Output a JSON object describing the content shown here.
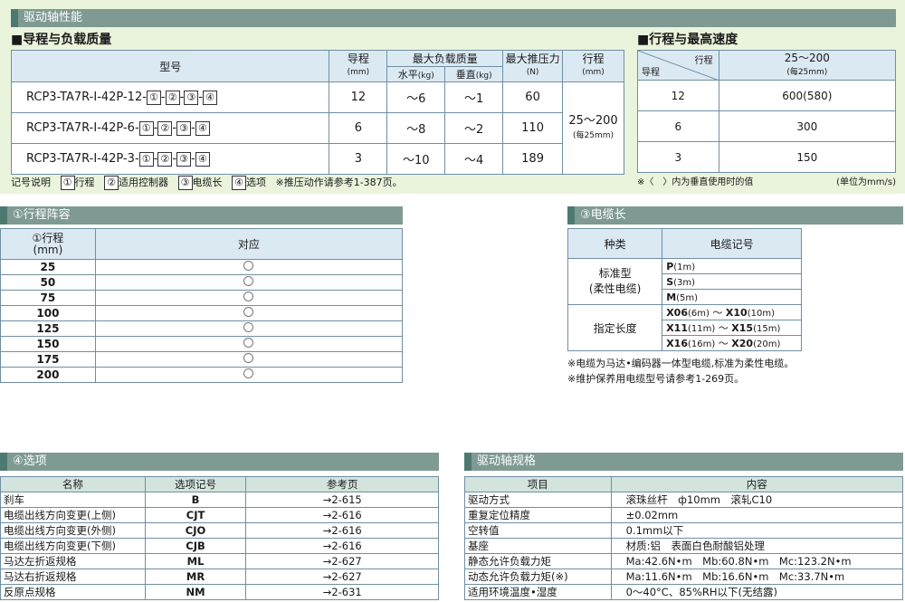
{
  "top_section": {
    "title": "驱动轴性能",
    "lead_table": {
      "heading": "■导程与负载质量",
      "h_model": "型号",
      "h_lead": "导程",
      "h_lead_unit": "(mm)",
      "h_max_load": "最大负载质量",
      "h_horizontal": "水平",
      "h_horizontal_unit": "(kg)",
      "h_vertical": "垂直",
      "h_vertical_unit": "(kg)",
      "h_max_push": "最大推压力",
      "h_max_push_unit": "(N)",
      "h_stroke": "行程",
      "h_stroke_unit": "(mm)",
      "stroke_value": "25～200",
      "stroke_step": "(每25mm)",
      "rows": [
        {
          "model_prefix": "RCP3-TA7R-I-42P-12-",
          "lead": "12",
          "horizontal": "～6",
          "vertical": "～1",
          "push": "60"
        },
        {
          "model_prefix": "RCP3-TA7R-I-42P-6-",
          "lead": "6",
          "horizontal": "～8",
          "vertical": "～2",
          "push": "110"
        },
        {
          "model_prefix": "RCP3-TA7R-I-42P-3-",
          "lead": "3",
          "horizontal": "～10",
          "vertical": "～4",
          "push": "189"
        }
      ],
      "model_boxes": [
        "①",
        "②",
        "③",
        "④"
      ],
      "model_dash": "-",
      "legend_label": "记号说明",
      "legend_items": [
        {
          "num": "①",
          "text": "行程"
        },
        {
          "num": "②",
          "text": "适用控制器"
        },
        {
          "num": "③",
          "text": "电缆长"
        },
        {
          "num": "④",
          "text": "选项"
        }
      ],
      "legend_note": "※推压动作请参考1-387页。"
    },
    "speed_table": {
      "heading": "■行程与最高速度",
      "h_stroke": "行程",
      "h_lead": "导程",
      "h_range": "25～200",
      "h_range_step": "(每25mm)",
      "rows": [
        {
          "lead": "12",
          "speed": "600(580)"
        },
        {
          "lead": "6",
          "speed": "300"
        },
        {
          "lead": "3",
          "speed": "150"
        }
      ],
      "note": "※〈　〉内为垂直使用时的值",
      "unit": "(单位为mm/s)"
    }
  },
  "stroke_section": {
    "title": "①行程阵容",
    "h_stroke": "①行程",
    "h_stroke_unit": "(mm)",
    "h_support": "对应",
    "rows": [
      "25",
      "50",
      "75",
      "100",
      "125",
      "150",
      "175",
      "200"
    ]
  },
  "cable_section": {
    "title": "③电缆长",
    "h_type": "种类",
    "h_code": "电缆记号",
    "standard_label": "标准型",
    "standard_sub": "(柔性电缆)",
    "standard_rows": [
      {
        "code": "P",
        "len": "(1m)"
      },
      {
        "code": "S",
        "len": "(3m)"
      },
      {
        "code": "M",
        "len": "(5m)"
      }
    ],
    "custom_label": "指定长度",
    "custom_rows": [
      {
        "from": "X06",
        "from_len": "(6m)",
        "tilde": "～",
        "to": "X10",
        "to_len": "(10m)"
      },
      {
        "from": "X11",
        "from_len": "(11m)",
        "tilde": "～",
        "to": "X15",
        "to_len": "(15m)"
      },
      {
        "from": "X16",
        "from_len": "(16m)",
        "tilde": "～",
        "to": "X20",
        "to_len": "(20m)"
      }
    ],
    "note1": "※电缆为马达•编码器一体型电缆,标准为柔性电缆。",
    "note2": "※维护保养用电缆型号请参考1-269页。"
  },
  "options_section": {
    "title": "④选项",
    "h_name": "名称",
    "h_code": "选项记号",
    "h_ref": "参考页",
    "rows": [
      {
        "name": "刹车",
        "code": "B",
        "ref": "→2-615"
      },
      {
        "name": "电缆出线方向变更(上侧)",
        "code": "CJT",
        "ref": "→2-616"
      },
      {
        "name": "电缆出线方向变更(外侧)",
        "code": "CJO",
        "ref": "→2-616"
      },
      {
        "name": "电缆出线方向变更(下侧)",
        "code": "CJB",
        "ref": "→2-616"
      },
      {
        "name": "马达左折返规格",
        "code": "ML",
        "ref": "→2-627"
      },
      {
        "name": "马达右折返规格",
        "code": "MR",
        "ref": "→2-627"
      },
      {
        "name": "反原点规格",
        "code": "NM",
        "ref": "→2-631"
      }
    ]
  },
  "spec_section": {
    "title": "驱动轴规格",
    "h_item": "项目",
    "h_content": "内容",
    "rows": [
      {
        "item": "驱动方式",
        "content": "滚珠丝杆　ф10mm　滚轧C10"
      },
      {
        "item": "重复定位精度",
        "content": "±0.02mm"
      },
      {
        "item": "空转值",
        "content": "0.1mm以下"
      },
      {
        "item": "基座",
        "content": "材质:铝　表面白色耐酸铝处理"
      },
      {
        "item": "静态允许负载力矩",
        "content": "Ma:42.6N•m　Mb:60.8N•m　Mc:123.2N•m"
      },
      {
        "item": "动态允许负载力矩(※)",
        "content": "Ma:11.6N•m　Mb:16.6N•m　Mc:33.7N•m"
      },
      {
        "item": "适用环境温度•湿度",
        "content": "0～40°C、85%RH以下(无结露)"
      }
    ]
  }
}
